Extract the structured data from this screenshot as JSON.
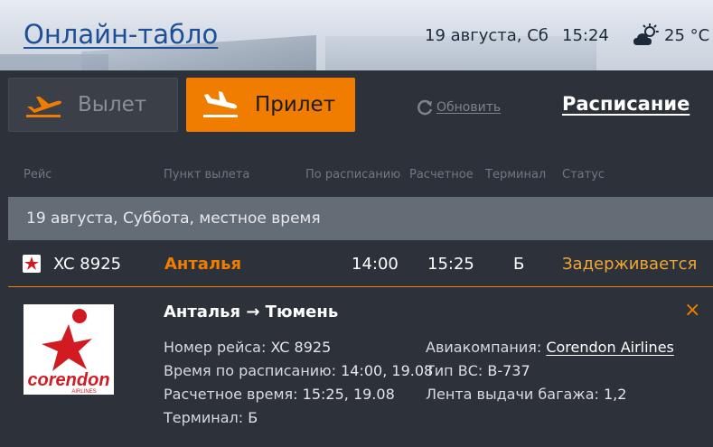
{
  "header": {
    "title": "Онлайн-табло",
    "date": "19 августа, Сб",
    "time": "15:24",
    "weather_icon": "partly-cloudy-icon",
    "temperature": "25 °C"
  },
  "tabs": [
    {
      "label": "Вылет",
      "icon": "departure-plane-icon",
      "active": false
    },
    {
      "label": "Прилет",
      "icon": "arrival-plane-icon",
      "active": true
    }
  ],
  "refresh_label": "Обновить",
  "schedule_label": "Расписание",
  "columns": [
    "Рейс",
    "Пункт вылета",
    "По расписанию",
    "Расчетное",
    "Терминал",
    "Статус"
  ],
  "date_group": "19 августа, Суббота, местное время",
  "flight": {
    "number": "XC 8925",
    "city": "Анталья",
    "scheduled": "14:00",
    "estimated": "15:25",
    "terminal": "Б",
    "status": "Задерживается"
  },
  "details": {
    "route": "Анталья → Тюмень",
    "flight_number_label": "Номер рейса:",
    "flight_number": "XC 8925",
    "scheduled_label": "Время по расписанию:",
    "scheduled": "14:00, 19.08",
    "estimated_label": "Расчетное время:",
    "estimated": "15:25, 19.08",
    "terminal_label": "Терминал:",
    "terminal": "Б",
    "airline_label": "Авиакомпания:",
    "airline": "Corendon Airlines",
    "aircraft_label": "Тип ВС:",
    "aircraft": "B-737",
    "baggage_label": "Лента выдачи багажа:",
    "baggage": "1,2",
    "close_symbol": "×"
  },
  "logo": {
    "brand": "corendon",
    "sub": "AIRLINES"
  },
  "colors": {
    "accent": "#f07c00",
    "panel": "#2d323a",
    "status_delayed": "#f0a634",
    "link_blue": "#1d4f96",
    "logo_red": "#d21a22"
  }
}
